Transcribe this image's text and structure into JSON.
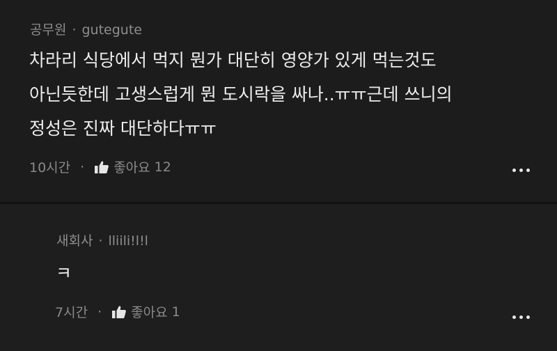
{
  "comments": [
    {
      "role": "공무원",
      "separator": "·",
      "username": "gutegute",
      "lines": [
        "차라리 식당에서 먹지 뭔가 대단히 영양가 있게 먹는것도",
        "아닌듯한데 고생스럽게 뭔 도시락을 싸나..ㅠㅠ근데 쓰니의",
        "정성은 진짜 대단하다ㅠㅠ"
      ],
      "time": "10시간",
      "dot": "·",
      "like_label": "좋아요",
      "like_count": "12",
      "icons": {
        "like": "thumbs-up-icon",
        "more": "more-horizontal-icon"
      }
    },
    {
      "role": "새회사",
      "separator": "·",
      "username": "lliili!l!l",
      "lines": [
        "ㅋ"
      ],
      "time": "7시간",
      "dot": "·",
      "like_label": "좋아요",
      "like_count": "1",
      "icons": {
        "like": "thumbs-up-icon",
        "more": "more-horizontal-icon"
      }
    }
  ],
  "colors": {
    "background": "#1c1c1c",
    "text": "#ededed",
    "meta": "#8e8e8e"
  }
}
